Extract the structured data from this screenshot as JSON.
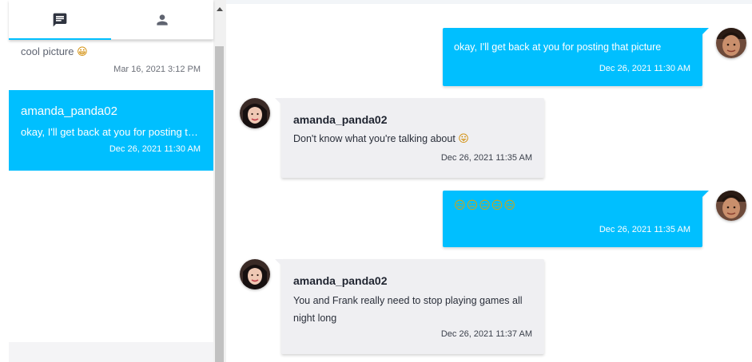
{
  "tabs": [
    {
      "id": "chats",
      "icon": "chat-icon",
      "active": true
    },
    {
      "id": "contacts",
      "icon": "person-icon",
      "active": false
    }
  ],
  "conversations": [
    {
      "preview": "cool picture",
      "preview_emoji": "😀",
      "time": "Mar 16, 2021 3:12 PM"
    },
    {
      "name": "amanda_panda02",
      "preview": "okay, I'll get back at you for posting that picture",
      "time": "Dec 26, 2021 11:30 AM",
      "active": true
    }
  ],
  "messages": [
    {
      "direction": "outgoing",
      "text": "okay, I'll get back at you for posting that picture",
      "time": "Dec 26, 2021 11:30 AM"
    },
    {
      "direction": "incoming",
      "sender": "amanda_panda02",
      "text": "Don't know what you're talking about",
      "emoji": "😛",
      "time": "Dec 26, 2021 11:35 AM"
    },
    {
      "direction": "outgoing",
      "text": "😑😑😑😑😑",
      "time": "Dec 26, 2021 11:35 AM"
    },
    {
      "direction": "incoming",
      "sender": "amanda_panda02",
      "text": "You and Frank really need to stop playing games all night long",
      "time": "Dec 26, 2021 11:37 AM"
    }
  ],
  "colors": {
    "accent": "#00bfff",
    "incoming_bubble": "#efeff2",
    "scrollbar_thumb": "#c1c1c1"
  }
}
